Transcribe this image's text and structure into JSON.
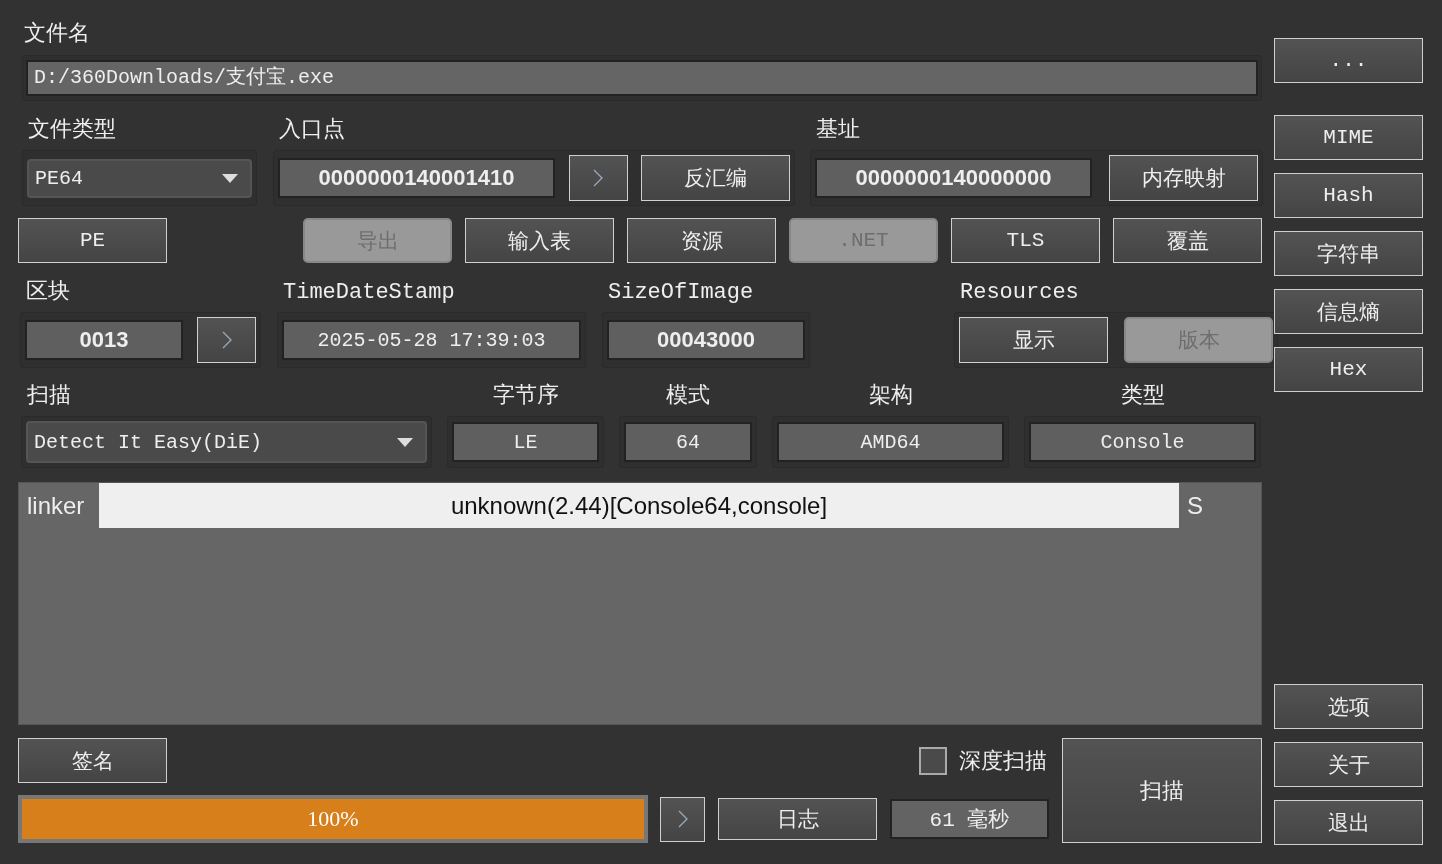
{
  "file_name": {
    "label": "文件名",
    "value": "D:/360Downloads/支付宝.exe"
  },
  "browse_button": "...",
  "file_type": {
    "label": "文件类型",
    "value": "PE64"
  },
  "entry_point": {
    "label": "入口点",
    "value": "0000000140001410",
    "disassemble_button": "反汇编"
  },
  "base_address": {
    "label": "基址",
    "value": "0000000140000000",
    "memory_map_button": "内存映射"
  },
  "info_buttons": [
    {
      "label": "PE",
      "disabled": false
    },
    {
      "label": "导出",
      "disabled": true
    },
    {
      "label": "输入表",
      "disabled": false
    },
    {
      "label": "资源",
      "disabled": false
    },
    {
      "label": ".NET",
      "disabled": true
    },
    {
      "label": "TLS",
      "disabled": false
    },
    {
      "label": "覆盖",
      "disabled": false
    }
  ],
  "section": {
    "label": "区块",
    "value": "0013"
  },
  "time_date_stamp": {
    "label": "TimeDateStamp",
    "value": "2025-05-28 17:39:03"
  },
  "size_of_image": {
    "label": "SizeOfImage",
    "value": "00043000"
  },
  "resources": {
    "label": "Resources",
    "buttons": [
      {
        "label": "显示",
        "disabled": false
      },
      {
        "label": "版本",
        "disabled": true
      }
    ]
  },
  "scan": {
    "label": "扫描",
    "engine": "Detect It Easy(DiE)"
  },
  "properties": [
    {
      "label": "字节序",
      "value": "LE"
    },
    {
      "label": "模式",
      "value": "64"
    },
    {
      "label": "架构",
      "value": "AMD64"
    },
    {
      "label": "类型",
      "value": "Console"
    }
  ],
  "results": [
    {
      "type": "linker",
      "name": "unknown(2.44)[Console64,console]",
      "flag": "S"
    }
  ],
  "signatures_button": "签名",
  "deep_scan": {
    "label": "深度扫描",
    "checked": false
  },
  "scan_button": "扫描",
  "progress": {
    "level": 1,
    "text": "100%"
  },
  "log_button": "日志",
  "elapsed": "61 毫秒",
  "side_tools": [
    "MIME",
    "Hash",
    "字符串",
    "信息熵",
    "Hex"
  ],
  "side_menu": [
    "选项",
    "关于",
    "退出"
  ]
}
